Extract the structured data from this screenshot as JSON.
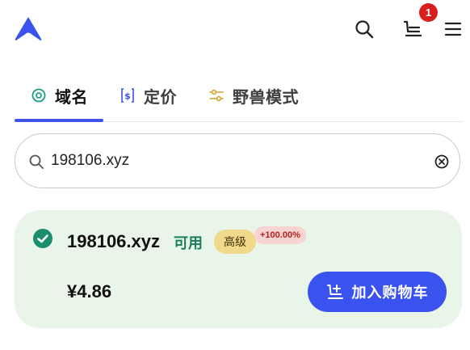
{
  "header": {
    "logo_icon": "brand-triangle-logo-icon",
    "search_icon": "search-icon",
    "cart_icon": "cart-icon",
    "cart_count": "1",
    "menu_icon": "hamburger-menu-icon"
  },
  "tabs": [
    {
      "label": "域名",
      "icon": "target-icon",
      "active": true
    },
    {
      "label": "定价",
      "icon": "price-tag-icon",
      "active": false
    },
    {
      "label": "野兽模式",
      "icon": "sliders-icon",
      "active": false
    }
  ],
  "search": {
    "value": "198106.xyz",
    "placeholder": ""
  },
  "result": {
    "domain": "198106.xyz",
    "availability": "可用",
    "tier_badge": "高级",
    "change_badge": "+100.00%",
    "price": "¥4.86",
    "add_to_cart_label": "加入购物车"
  },
  "colors": {
    "accent": "#3a52ee",
    "available": "#1b7f5e",
    "card_bg": "#e9f5e8",
    "premium_bg": "#f0d98a",
    "change_bg": "#f7d3d2",
    "badge_red": "#d71f1f"
  }
}
